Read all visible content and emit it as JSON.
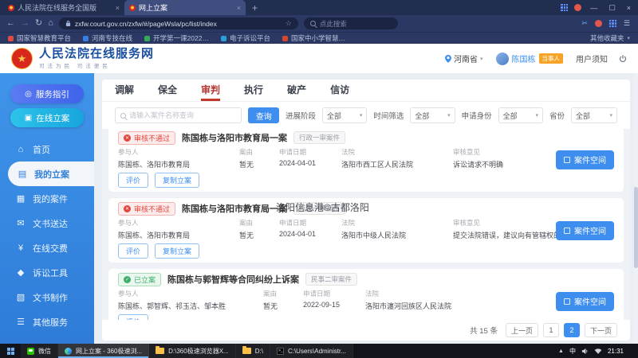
{
  "browser": {
    "tab1": "人民法院在线服务全国版",
    "tab2": "网上立案",
    "url": "zxfw.court.gov.cn/zxfw/#/pageWsla/pc/list/index",
    "search_placeholder": "点此搜索",
    "bookmarks": [
      "国家智慧教育平台",
      "河南专技在线",
      "开学第一课2022…",
      "电子诉讼平台",
      "国家中小学智慧…"
    ],
    "other_bookmarks": "其他收藏夹"
  },
  "header": {
    "title": "人民法院在线服务网",
    "subtitle": "司法为民 司法便民",
    "region": "河南省",
    "user": "陈国栋",
    "badge": "当事人",
    "notice": "用户须知"
  },
  "sidebar": {
    "guide": "服务指引",
    "filing": "在线立案",
    "items": [
      "首页",
      "我的立案",
      "我的案件",
      "文书送达",
      "在线交费",
      "诉讼工具",
      "文书制作",
      "其他服务"
    ]
  },
  "tabs": [
    "调解",
    "保全",
    "审判",
    "执行",
    "破产",
    "信访"
  ],
  "filters": {
    "search_placeholder": "请输入案件名称查询",
    "search_btn": "查询",
    "f1_label": "进展阶段",
    "f1_value": "全部",
    "f2_label": "时间筛选",
    "f2_value": "全部",
    "f3_label": "申请身份",
    "f3_value": "全部",
    "f4_label": "省份",
    "f4_value": "全部"
  },
  "labels": {
    "participants": "参与人",
    "cause": "案由",
    "date": "申请日期",
    "court": "法院",
    "opinion": "审核意见"
  },
  "cases": [
    {
      "status": "审核不通过",
      "title": "陈国栋与洛阳市教育局一案",
      "tag": "行政一审案件",
      "participants": "陈国栋、洛阳市教育局",
      "cause": "暂无",
      "date": "2024-04-01",
      "court": "洛阳市西工区人民法院",
      "opinion": "诉讼请求不明确",
      "rate": "评价",
      "copy": "复制立案",
      "space": "案件空间"
    },
    {
      "status": "审核不通过",
      "title": "陈国栋与洛阳市教育局一案",
      "tag": "行政一审案件",
      "participants": "陈国栋、洛阳市教育局",
      "cause": "暂无",
      "date": "2024-04-01",
      "court": "洛阳市中级人民法院",
      "opinion": "提交法院错误，建议向有管辖权的人民法院提起诉讼。",
      "rate": "评价",
      "copy": "复制立案",
      "space": "案件空间"
    },
    {
      "status": "已立案",
      "title": "陈国栋与郭智辉等合同纠纷上诉案",
      "tag": "民事二审案件",
      "participants": "陈国栋、郭智辉、祁玉洁、邹本胜",
      "cause": "暂无",
      "date": "2022-09-15",
      "court": "洛阳市瀍河回族区人民法院",
      "rate": "评价",
      "space": "案件空间"
    }
  ],
  "watermark": "洛阳信息港©古都洛阳",
  "pagination": {
    "total": "共 15 条",
    "prev": "上一页",
    "p1": "1",
    "p2": "2",
    "next": "下一页"
  },
  "taskbar": {
    "wechat": "微信",
    "win1": "网上立案 - 360极速浏...",
    "win2": "D:\\360极速浏览器X...",
    "win3": "D:\\",
    "win4": "C:\\Users\\Administr...",
    "ime": "中",
    "time": "21:31"
  },
  "colors": {
    "accent": "#3e8ef0",
    "error": "#e2463c",
    "success": "#3fae6c",
    "brand": "#1b4fa0"
  }
}
